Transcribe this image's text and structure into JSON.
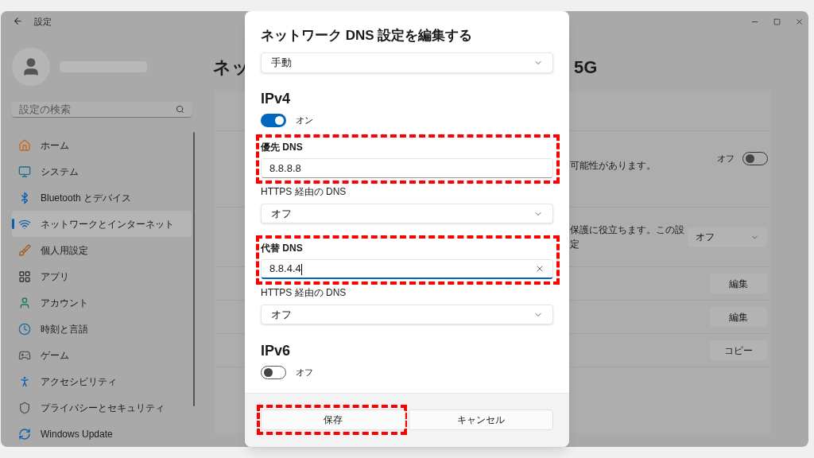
{
  "window": {
    "title": "設定"
  },
  "sidebar": {
    "search": {
      "placeholder": "設定の検索"
    },
    "items": [
      {
        "label": "ホーム",
        "selected": false
      },
      {
        "label": "システム",
        "selected": false
      },
      {
        "label": "Bluetooth とデバイス",
        "selected": false
      },
      {
        "label": "ネットワークとインターネット",
        "selected": true
      },
      {
        "label": "個人用設定",
        "selected": false
      },
      {
        "label": "アプリ",
        "selected": false
      },
      {
        "label": "アカウント",
        "selected": false
      },
      {
        "label": "時刻と言語",
        "selected": false
      },
      {
        "label": "ゲーム",
        "selected": false
      },
      {
        "label": "アクセシビリティ",
        "selected": false
      },
      {
        "label": "プライバシーとセキュリティ",
        "selected": false
      },
      {
        "label": "Windows Update",
        "selected": false
      }
    ]
  },
  "content": {
    "heading_start": "ネッ",
    "heading_end": "5G",
    "rows": [
      {
        "kind": "toggle",
        "text": "可能性があります。",
        "state_label": "オフ",
        "on": false
      },
      {
        "kind": "select",
        "text": "保護に役立ちます。この設定",
        "value": "オフ"
      },
      {
        "kind": "button",
        "label": "編集"
      },
      {
        "kind": "button",
        "label": "編集"
      },
      {
        "kind": "button",
        "label": "コピー"
      }
    ]
  },
  "dialog": {
    "title": "ネットワーク DNS 設定を編集する",
    "mode": {
      "value": "手動"
    },
    "sections": [
      {
        "heading": "IPv4",
        "on": true,
        "state_label": "オン",
        "fields": [
          {
            "label": "優先 DNS",
            "value": "8.8.8.8",
            "focused": false,
            "highlighted": true,
            "https_label": "HTTPS 経由の DNS",
            "https_value": "オフ"
          },
          {
            "label": "代替 DNS",
            "value": "8.8.4.4",
            "focused": true,
            "highlighted": true,
            "https_label": "HTTPS 経由の DNS",
            "https_value": "オフ"
          }
        ]
      },
      {
        "heading": "IPv6",
        "on": false,
        "state_label": "オフ"
      }
    ],
    "buttons": [
      {
        "label": "保存",
        "highlighted": true
      },
      {
        "label": "キャンセル",
        "highlighted": false
      }
    ]
  }
}
